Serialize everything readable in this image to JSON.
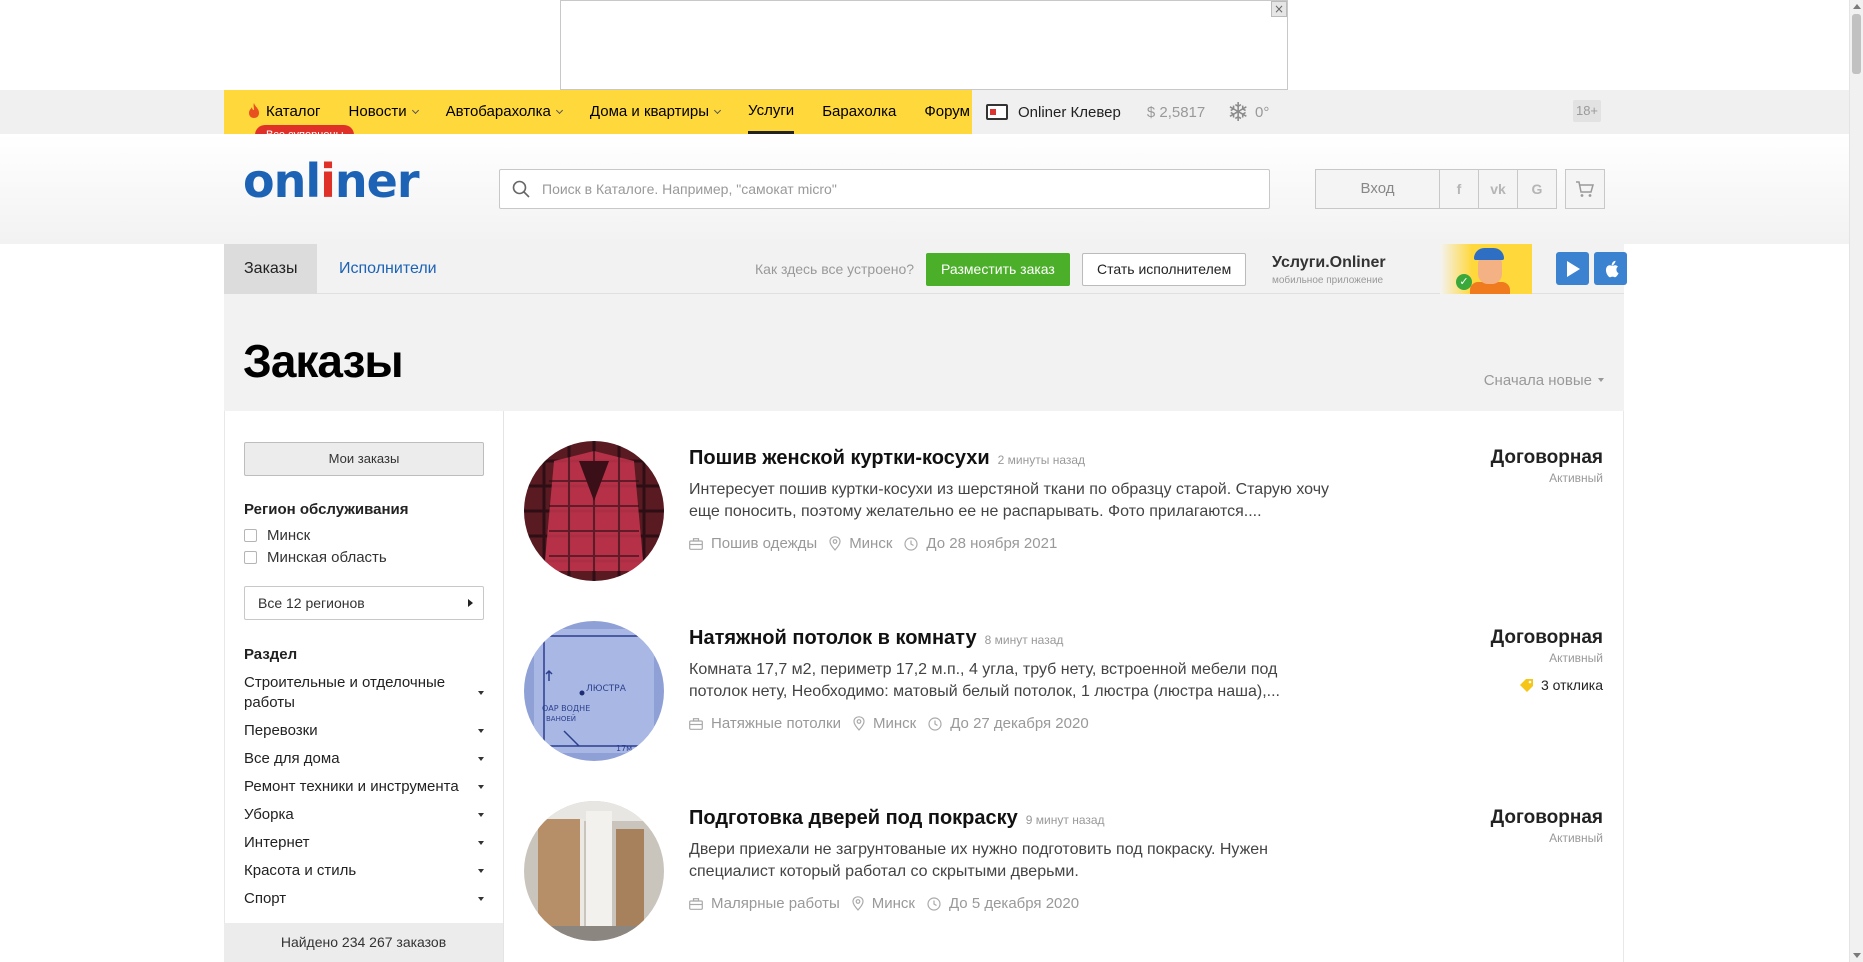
{
  "ad": {
    "close_label": "×"
  },
  "topnav": {
    "items": [
      {
        "label": "Каталог",
        "chevron": false,
        "active": false
      },
      {
        "label": "Новости",
        "chevron": true,
        "active": false
      },
      {
        "label": "Автобарахолка",
        "chevron": true,
        "active": false
      },
      {
        "label": "Дома и квартиры",
        "chevron": true,
        "active": false
      },
      {
        "label": "Услуги",
        "chevron": false,
        "active": true
      },
      {
        "label": "Барахолка",
        "chevron": false,
        "active": false
      },
      {
        "label": "Форум",
        "chevron": false,
        "active": false
      }
    ],
    "supercena_badge": "Все суперцены",
    "klever_label": "Onliner Клевер",
    "currency_rate": "$ 2,5817",
    "temperature": "0°",
    "age_badge": "18+"
  },
  "header": {
    "logo_start": "onl",
    "logo_i": "i",
    "logo_end": "ner",
    "search_placeholder": "Поиск в Каталоге. Например, \"самокат micro\"",
    "login_label": "Вход",
    "social": [
      "f",
      "vk",
      "G"
    ]
  },
  "subnav": {
    "tab_orders": "Заказы",
    "tab_performers": "Исполнители",
    "how_it_works": "Как здесь все устроено?",
    "place_order": "Разместить заказ",
    "become_performer": "Стать исполнителем",
    "app_title": "Услуги.Onliner",
    "app_subtitle": "мобильное приложение"
  },
  "title_area": {
    "title": "Заказы",
    "sort_label": "Сначала новые"
  },
  "sidebar": {
    "my_orders": "Мои заказы",
    "region_heading": "Регион обслуживания",
    "regions": [
      "Минск",
      "Минская область"
    ],
    "all_regions": "Все 12 регионов",
    "section_heading": "Раздел",
    "sections": [
      "Строительные и отделочные работы",
      "Перевозки",
      "Все для дома",
      "Ремонт техники и инструмента",
      "Уборка",
      "Интернет",
      "Красота и стиль",
      "Спорт"
    ],
    "found": "Найдено 234 267 заказов"
  },
  "orders": [
    {
      "title": "Пошив женской куртки-косухи",
      "time": "2 минуты назад",
      "description": "Интересует пошив куртки-косухи из шерстяной ткани по образцу старой. Старую хочу еще поносить, поэтому желательно ее не распарывать. Фото прилагаются....",
      "category": "Пошив одежды",
      "city": "Минск",
      "deadline": "До 28 ноября 2021",
      "price": "Договорная",
      "status": "Активный",
      "responses": ""
    },
    {
      "title": "Натяжной потолок в комнату",
      "time": "8 минут назад",
      "description": "Комната 17,7 м2, периметр 17,2 м.п., 4 угла, труб нету, встроенной мебели под потолок нету, Необходимо: матовый белый потолок, 1 люстра (люстра наша),...",
      "category": "Натяжные потолки",
      "city": "Минск",
      "deadline": "До 27 декабря 2020",
      "price": "Договорная",
      "status": "Активный",
      "responses": "3 отклика"
    },
    {
      "title": "Подготовка дверей под покраску",
      "time": "9 минут назад",
      "description": "Двери приехали не загрунтованые их нужно подготовить под покраску. Нужен специалист который работал со скрытыми дверьми.",
      "category": "Малярные работы",
      "city": "Минск",
      "deadline": "До 5 декабря 2020",
      "price": "Договорная",
      "status": "Активный",
      "responses": ""
    }
  ],
  "colors": {
    "brand_blue": "#1c62b5",
    "brand_red": "#e03128",
    "nav_yellow": "#ffd83c",
    "green_button": "#4caf2a"
  }
}
